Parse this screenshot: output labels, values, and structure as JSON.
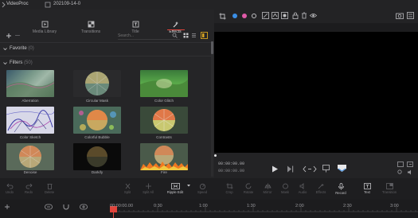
{
  "app": {
    "name": "VideoProc",
    "project": "202109-14-0"
  },
  "tabs": [
    {
      "label": "Media Library",
      "icon": "media-library-icon",
      "active": false
    },
    {
      "label": "Transitions",
      "icon": "transitions-icon",
      "active": false
    },
    {
      "label": "Title",
      "icon": "title-icon",
      "active": false
    },
    {
      "label": "Effects",
      "icon": "effects-icon",
      "active": true
    }
  ],
  "search": {
    "placeholder": "Search..."
  },
  "favorite": {
    "label": "Favorite",
    "count": "(0)"
  },
  "filters": {
    "label": "Filters",
    "count": "(50)"
  },
  "effects": [
    {
      "label": "Aberration"
    },
    {
      "label": "Circular Mask"
    },
    {
      "label": "Color Glitch"
    },
    {
      "label": "Color Sketch"
    },
    {
      "label": "Colorful Bubble"
    },
    {
      "label": "Contrasts"
    },
    {
      "label": "Denoise"
    },
    {
      "label": "Darkify"
    },
    {
      "label": "Fire"
    }
  ],
  "preview": {
    "timecode": "00:00:00.00",
    "timecode2": "00:00:00.00"
  },
  "edit_tools": [
    {
      "label": "Undo",
      "on": false
    },
    {
      "label": "Redo",
      "on": false
    },
    {
      "label": "Delete",
      "on": false
    },
    {
      "label": "Split",
      "on": false
    },
    {
      "label": "Split All",
      "on": false
    },
    {
      "label": "Ripple Edit",
      "on": true
    },
    {
      "label": "Speed",
      "on": false
    },
    {
      "label": "Crop",
      "on": false
    },
    {
      "label": "Rotate",
      "on": false
    },
    {
      "label": "Mirror",
      "on": false
    },
    {
      "label": "Mask",
      "on": false
    },
    {
      "label": "Audio",
      "on": false
    },
    {
      "label": "Effects",
      "on": false
    },
    {
      "label": "Record",
      "on": true
    },
    {
      "label": "Text",
      "on": true
    },
    {
      "label": "Transition",
      "on": false
    }
  ],
  "ruler": [
    "00:00:00.00",
    "0:30",
    "1:00",
    "1:30",
    "2:00",
    "2:30",
    "3:00"
  ],
  "colors": {
    "accent": "#e0443b",
    "viewer": "#000000",
    "marker_blue": "#3a8ee6",
    "marker_pink": "#e05aa8"
  }
}
